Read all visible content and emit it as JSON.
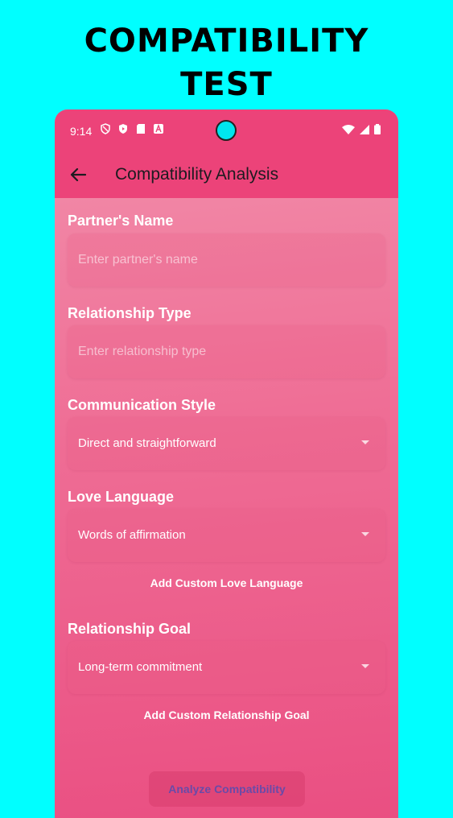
{
  "promo": {
    "title_line1": "COMPATIBILITY",
    "title_line2": "TEST"
  },
  "status_bar": {
    "time": "9:14"
  },
  "app_bar": {
    "title": "Compatibility Analysis"
  },
  "form": {
    "partner_name": {
      "label": "Partner's Name",
      "placeholder": "Enter partner's name",
      "value": ""
    },
    "relationship_type": {
      "label": "Relationship Type",
      "placeholder": "Enter relationship type",
      "value": ""
    },
    "communication_style": {
      "label": "Communication Style",
      "selected": "Direct and straightforward"
    },
    "love_language": {
      "label": "Love Language",
      "selected": "Words of affirmation",
      "custom_button": "Add Custom Love Language"
    },
    "relationship_goal": {
      "label": "Relationship Goal",
      "selected": "Long-term commitment",
      "custom_button": "Add Custom Relationship Goal"
    }
  },
  "analyze_button": "Analyze Compatibility",
  "colors": {
    "background": "#00ffff",
    "app_bar": "#ec4379",
    "accent_button_text": "#6a4aa8"
  }
}
